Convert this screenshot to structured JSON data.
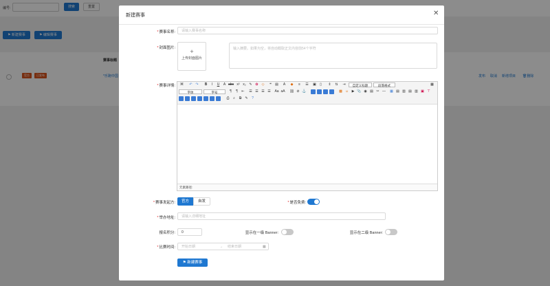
{
  "background": {
    "filter_label": "编号:",
    "search_button": "搜索",
    "reset_button": "重置",
    "new_event_button": "新建赛事",
    "edit_event_button": "编辑赛事",
    "table_header_title": "赛事标题",
    "row_tag_official": "官方",
    "row_tag_status": "已发布",
    "row_title": "*乐跑中国",
    "row_ops": [
      "发布",
      "取消",
      "新增项目",
      "删除"
    ]
  },
  "modal": {
    "title": "新建赛事",
    "close_icon": "close-icon",
    "name_label": "赛事名称:",
    "name_placeholder": "请输入赛事名称",
    "cover_label": "封面图片:",
    "upload_text": "上传封面图片",
    "summary_placeholder": "输入摘要。如果为空，将自动截取正文内容前54个字符",
    "details_label": "赛事详情:",
    "editor": {
      "font_family": "字体",
      "font_size": "字号",
      "custom_title": "自定义标题",
      "paragraph_format": "段落格式",
      "path_label": "元素路径:"
    },
    "organizer_label": "赛事发起方:",
    "organizer_options": [
      "官方",
      "自发"
    ],
    "free_label": "是否免费:",
    "free_on": true,
    "address_label": "举办地址:",
    "address_placeholder": "请输入详细地址",
    "points_label": "报名积分:",
    "points_value": "0",
    "banner1_label": "显示在一级 Banner:",
    "banner1_on": false,
    "banner2_label": "显示在二级 Banner:",
    "banner2_on": false,
    "time_label": "比赛时间:",
    "start_placeholder": "开始日期",
    "range_sep": "→",
    "end_placeholder": "结束日期",
    "submit_label": "新建赛事"
  }
}
